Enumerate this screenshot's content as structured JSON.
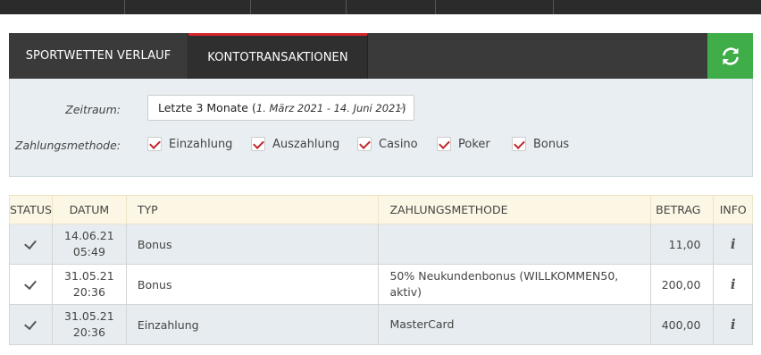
{
  "tabs": [
    {
      "label": "SPORTWETTEN VERLAUF",
      "active": false
    },
    {
      "label": "KONTOTRANSAKTIONEN",
      "active": true
    }
  ],
  "colors": {
    "active_tab_border": "#d6262b",
    "refresh_bg": "#3fae49",
    "check": "#c0282d",
    "header_bg": "#fcf7e4"
  },
  "filters": {
    "zeitraum_label": "Zeitraum:",
    "zeitraum_value": "Letzte 3 Monate",
    "zeitraum_open": "(",
    "zeitraum_range": "1. März 2021 - 14. Juni 2021",
    "zeitraum_close": ")",
    "zahlungsmethode_label": "Zahlungsmethode:",
    "checkboxes": [
      {
        "label": "Einzahlung",
        "checked": true
      },
      {
        "label": "Auszahlung",
        "checked": true
      },
      {
        "label": "Casino",
        "checked": true
      },
      {
        "label": "Poker",
        "checked": true
      },
      {
        "label": "Bonus",
        "checked": true
      }
    ]
  },
  "table": {
    "headers": [
      "STATUS",
      "DATUM",
      "TYP",
      "ZAHLUNGSMETHODE",
      "BETRAG",
      "INFO"
    ],
    "rows": [
      {
        "date": "14.06.21",
        "time": "05:49",
        "typ": "Bonus",
        "method": "",
        "amount": "11,00",
        "info": "i"
      },
      {
        "date": "31.05.21",
        "time": "20:36",
        "typ": "Bonus",
        "method": "50% Neukundenbonus (WILLKOMMEN50, aktiv)",
        "amount": "200,00",
        "info": "i"
      },
      {
        "date": "31.05.21",
        "time": "20:36",
        "typ": "Einzahlung",
        "method": "MasterCard",
        "amount": "400,00",
        "info": "i"
      }
    ]
  }
}
